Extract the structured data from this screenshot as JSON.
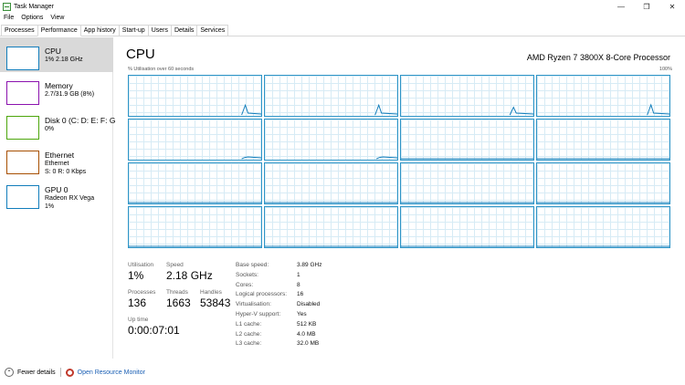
{
  "window": {
    "title": "Task Manager",
    "minimize": "—",
    "restore": "❐",
    "close": "✕"
  },
  "menu": [
    "File",
    "Options",
    "View"
  ],
  "tabs": [
    "Processes",
    "Performance",
    "App history",
    "Start-up",
    "Users",
    "Details",
    "Services"
  ],
  "active_tab": "Performance",
  "sidebar": {
    "items": [
      {
        "name": "CPU",
        "line1": "1%  2.18 GHz",
        "line2": "",
        "color": "#117dbb"
      },
      {
        "name": "Memory",
        "line1": "2.7/31.9 GB (8%)",
        "line2": "",
        "color": "#8b12ae"
      },
      {
        "name": "Disk 0 (C: D: E: F: G",
        "line1": "0%",
        "line2": "",
        "color": "#4da60c"
      },
      {
        "name": "Ethernet",
        "line1": "Ethernet",
        "line2": "S: 0 R: 0 Kbps",
        "color": "#a74f01"
      },
      {
        "name": "GPU 0",
        "line1": "Radeon RX Vega",
        "line2": "1%",
        "color": "#117dbb"
      }
    ]
  },
  "main": {
    "title": "CPU",
    "model": "AMD Ryzen 7 3800X 8-Core Processor",
    "axis_left": "% Utilisation over 60 seconds",
    "axis_right": "100%",
    "core_count": 16
  },
  "stats": {
    "utilisation_label": "Utilisation",
    "utilisation": "1%",
    "speed_label": "Speed",
    "speed": "2.18 GHz",
    "processes_label": "Processes",
    "processes": "136",
    "threads_label": "Threads",
    "threads": "1663",
    "handles_label": "Handles",
    "handles": "53843",
    "uptime_label": "Up time",
    "uptime": "0:00:07:01"
  },
  "specs": [
    {
      "label": "Base speed:",
      "value": "3.89 GHz"
    },
    {
      "label": "Sockets:",
      "value": "1"
    },
    {
      "label": "Cores:",
      "value": "8"
    },
    {
      "label": "Logical processors:",
      "value": "16"
    },
    {
      "label": "Virtualisation:",
      "value": "Disabled"
    },
    {
      "label": "Hyper-V support:",
      "value": "Yes"
    },
    {
      "label": "L1 cache:",
      "value": "512 KB"
    },
    {
      "label": "L2 cache:",
      "value": "4.0 MB"
    },
    {
      "label": "L3 cache:",
      "value": "32.0 MB"
    }
  ],
  "footer": {
    "fewer_details": "Fewer details",
    "open_monitor": "Open Resource Monitor"
  },
  "colors": {
    "graph_line": "#117dbb",
    "graph_border": "#2f95c7"
  }
}
